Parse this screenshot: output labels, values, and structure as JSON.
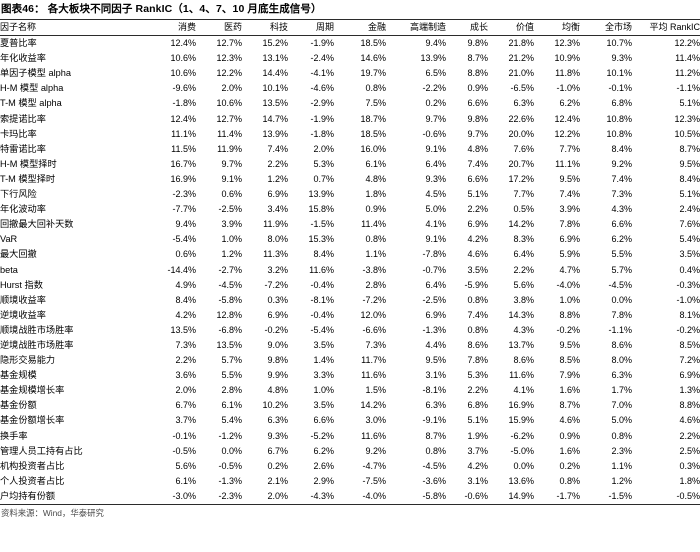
{
  "exhibit": {
    "title": "图表46：  各大板块不同因子 RankIC（1、4、7、10 月底生成信号）",
    "source": "资料来源：Wind，华泰研究"
  },
  "table": {
    "columns": [
      "因子名称",
      "消费",
      "医药",
      "科技",
      "周期",
      "金融",
      "高端制造",
      "成长",
      "价值",
      "均衡",
      "全市场",
      "平均 RankIC"
    ],
    "rows": [
      {
        "name": "夏普比率",
        "values": [
          "12.4%",
          "12.7%",
          "15.2%",
          "-1.9%",
          "18.5%",
          "9.4%",
          "9.8%",
          "21.8%",
          "12.3%",
          "10.7%",
          "12.2%"
        ]
      },
      {
        "name": "年化收益率",
        "values": [
          "10.6%",
          "12.3%",
          "13.1%",
          "-2.4%",
          "14.6%",
          "13.9%",
          "8.7%",
          "21.2%",
          "10.9%",
          "9.3%",
          "11.4%"
        ]
      },
      {
        "name": "单因子模型 alpha",
        "values": [
          "10.6%",
          "12.2%",
          "14.4%",
          "-4.1%",
          "19.7%",
          "6.5%",
          "8.8%",
          "21.0%",
          "11.8%",
          "10.1%",
          "11.2%"
        ]
      },
      {
        "name": "H-M 模型 alpha",
        "values": [
          "-9.6%",
          "2.0%",
          "10.1%",
          "-4.6%",
          "0.8%",
          "-2.2%",
          "0.9%",
          "-6.5%",
          "-1.0%",
          "-0.1%",
          "-1.1%"
        ]
      },
      {
        "name": "T-M 模型 alpha",
        "values": [
          "-1.8%",
          "10.6%",
          "13.5%",
          "-2.9%",
          "7.5%",
          "0.2%",
          "6.6%",
          "6.3%",
          "6.2%",
          "6.8%",
          "5.1%"
        ]
      },
      {
        "name": "索提诺比率",
        "values": [
          "12.4%",
          "12.7%",
          "14.7%",
          "-1.9%",
          "18.7%",
          "9.7%",
          "9.8%",
          "22.6%",
          "12.4%",
          "10.8%",
          "12.3%"
        ]
      },
      {
        "name": "卡玛比率",
        "values": [
          "11.1%",
          "11.4%",
          "13.9%",
          "-1.8%",
          "18.5%",
          "-0.6%",
          "9.7%",
          "20.0%",
          "12.2%",
          "10.8%",
          "10.5%"
        ]
      },
      {
        "name": "特雷诺比率",
        "values": [
          "11.5%",
          "11.9%",
          "7.4%",
          "2.0%",
          "16.0%",
          "9.1%",
          "4.8%",
          "7.6%",
          "7.7%",
          "8.4%",
          "8.7%"
        ]
      },
      {
        "name": "H-M 模型择时",
        "values": [
          "16.7%",
          "9.7%",
          "2.2%",
          "5.3%",
          "6.1%",
          "6.4%",
          "7.4%",
          "20.7%",
          "11.1%",
          "9.2%",
          "9.5%"
        ]
      },
      {
        "name": "T-M 模型择时",
        "values": [
          "16.9%",
          "9.1%",
          "1.2%",
          "0.7%",
          "4.8%",
          "9.3%",
          "6.6%",
          "17.2%",
          "9.5%",
          "7.4%",
          "8.4%"
        ]
      },
      {
        "name": "下行风险",
        "values": [
          "-2.3%",
          "0.6%",
          "6.9%",
          "13.9%",
          "1.8%",
          "4.5%",
          "5.1%",
          "7.7%",
          "7.4%",
          "7.3%",
          "5.1%"
        ]
      },
      {
        "name": "年化波动率",
        "values": [
          "-7.7%",
          "-2.5%",
          "3.4%",
          "15.8%",
          "0.9%",
          "5.0%",
          "2.2%",
          "0.5%",
          "3.9%",
          "4.3%",
          "2.4%"
        ]
      },
      {
        "name": "回撤最大回补天数",
        "values": [
          "9.4%",
          "3.9%",
          "11.9%",
          "-1.5%",
          "11.4%",
          "4.1%",
          "6.9%",
          "14.2%",
          "7.8%",
          "6.6%",
          "7.6%"
        ]
      },
      {
        "name": "VaR",
        "values": [
          "-5.4%",
          "1.0%",
          "8.0%",
          "15.3%",
          "0.8%",
          "9.1%",
          "4.2%",
          "8.3%",
          "6.9%",
          "6.2%",
          "5.4%"
        ]
      },
      {
        "name": "最大回撤",
        "values": [
          "0.6%",
          "1.2%",
          "11.3%",
          "8.4%",
          "1.1%",
          "-7.8%",
          "4.6%",
          "6.4%",
          "5.9%",
          "5.5%",
          "3.5%"
        ]
      },
      {
        "name": "beta",
        "values": [
          "-14.4%",
          "-2.7%",
          "3.2%",
          "11.6%",
          "-3.8%",
          "-0.7%",
          "3.5%",
          "2.2%",
          "4.7%",
          "5.7%",
          "0.4%"
        ]
      },
      {
        "name": "Hurst 指数",
        "values": [
          "4.9%",
          "-4.5%",
          "-7.2%",
          "-0.4%",
          "2.8%",
          "6.4%",
          "-5.9%",
          "5.6%",
          "-4.0%",
          "-4.5%",
          "-0.3%"
        ]
      },
      {
        "name": "顺境收益率",
        "values": [
          "8.4%",
          "-5.8%",
          "0.3%",
          "-8.1%",
          "-7.2%",
          "-2.5%",
          "0.8%",
          "3.8%",
          "1.0%",
          "0.0%",
          "-1.0%"
        ]
      },
      {
        "name": "逆境收益率",
        "values": [
          "4.2%",
          "12.8%",
          "6.9%",
          "-0.4%",
          "12.0%",
          "6.9%",
          "7.4%",
          "14.3%",
          "8.8%",
          "7.8%",
          "8.1%"
        ]
      },
      {
        "name": "顺境战胜市场胜率",
        "values": [
          "13.5%",
          "-6.8%",
          "-0.2%",
          "-5.4%",
          "-6.6%",
          "-1.3%",
          "0.8%",
          "4.3%",
          "-0.2%",
          "-1.1%",
          "-0.2%"
        ]
      },
      {
        "name": "逆境战胜市场胜率",
        "values": [
          "7.3%",
          "13.5%",
          "9.0%",
          "3.5%",
          "7.3%",
          "4.4%",
          "8.6%",
          "13.7%",
          "9.5%",
          "8.6%",
          "8.5%"
        ]
      },
      {
        "name": "隐形交易能力",
        "values": [
          "2.2%",
          "5.7%",
          "9.8%",
          "1.4%",
          "11.7%",
          "9.5%",
          "7.8%",
          "8.6%",
          "8.5%",
          "8.0%",
          "7.2%"
        ]
      },
      {
        "name": "基金规模",
        "values": [
          "3.6%",
          "5.5%",
          "9.9%",
          "3.3%",
          "11.6%",
          "3.1%",
          "5.3%",
          "11.6%",
          "7.9%",
          "6.3%",
          "6.9%"
        ]
      },
      {
        "name": "基金规模增长率",
        "values": [
          "2.0%",
          "2.8%",
          "4.8%",
          "1.0%",
          "1.5%",
          "-8.1%",
          "2.2%",
          "4.1%",
          "1.6%",
          "1.7%",
          "1.3%"
        ]
      },
      {
        "name": "基金份额",
        "values": [
          "6.7%",
          "6.1%",
          "10.2%",
          "3.5%",
          "14.2%",
          "6.3%",
          "6.8%",
          "16.9%",
          "8.7%",
          "7.0%",
          "8.8%"
        ]
      },
      {
        "name": "基金份额增长率",
        "values": [
          "3.7%",
          "5.4%",
          "6.3%",
          "6.6%",
          "3.0%",
          "-9.1%",
          "5.1%",
          "15.9%",
          "4.6%",
          "5.0%",
          "4.6%"
        ]
      },
      {
        "name": "换手率",
        "values": [
          "-0.1%",
          "-1.2%",
          "9.3%",
          "-5.2%",
          "11.6%",
          "8.7%",
          "1.9%",
          "-6.2%",
          "0.9%",
          "0.8%",
          "2.2%"
        ]
      },
      {
        "name": "管理人员工持有占比",
        "values": [
          "-0.5%",
          "0.0%",
          "6.7%",
          "6.2%",
          "9.2%",
          "0.8%",
          "3.7%",
          "-5.0%",
          "1.6%",
          "2.3%",
          "2.5%"
        ]
      },
      {
        "name": "机构投资者占比",
        "values": [
          "5.6%",
          "-0.5%",
          "0.2%",
          "2.6%",
          "-4.7%",
          "-4.5%",
          "4.2%",
          "0.0%",
          "0.2%",
          "1.1%",
          "0.3%"
        ]
      },
      {
        "name": "个人投资者占比",
        "values": [
          "6.1%",
          "-1.3%",
          "2.1%",
          "2.9%",
          "-7.5%",
          "-3.6%",
          "3.1%",
          "13.6%",
          "0.8%",
          "1.2%",
          "1.8%"
        ]
      },
      {
        "name": "户均持有份额",
        "values": [
          "-3.0%",
          "-2.3%",
          "2.0%",
          "-4.3%",
          "-4.0%",
          "-5.8%",
          "-0.6%",
          "14.9%",
          "-1.7%",
          "-1.5%",
          "-0.5%"
        ]
      }
    ]
  }
}
